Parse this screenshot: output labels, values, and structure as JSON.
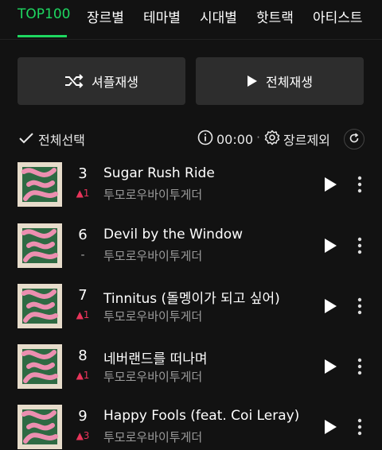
{
  "tabs": [
    {
      "label": "TOP100",
      "active": true
    },
    {
      "label": "장르별"
    },
    {
      "label": "테마별"
    },
    {
      "label": "시대별"
    },
    {
      "label": "핫트랙"
    },
    {
      "label": "아티스트"
    }
  ],
  "actions": {
    "shuffle_label": "셔플재생",
    "play_all_label": "전체재생"
  },
  "toolbar": {
    "select_all": "전체선택",
    "time": "00:00",
    "separator": "·",
    "genre_exclude": "장르제외"
  },
  "tracks": [
    {
      "rank": "3",
      "change": "▲1",
      "title": "Sugar Rush Ride",
      "artist": "투모로우바이투게더"
    },
    {
      "rank": "6",
      "change": "-",
      "title": "Devil by the Window",
      "artist": "투모로우바이투게더"
    },
    {
      "rank": "7",
      "change": "▲1",
      "title": "Tinnitus (돌멩이가 되고 싶어)",
      "artist": "투모로우바이투게더"
    },
    {
      "rank": "8",
      "change": "▲1",
      "title": "네버랜드를 떠나며",
      "artist": "투모로우바이투게더"
    },
    {
      "rank": "9",
      "change": "▲3",
      "title": "Happy Fools (feat. Coi Leray)",
      "artist": "투모로우바이투게더"
    }
  ],
  "colors": {
    "accent": "#1ed760",
    "rank_up": "#e8345a",
    "background": "#121212"
  }
}
